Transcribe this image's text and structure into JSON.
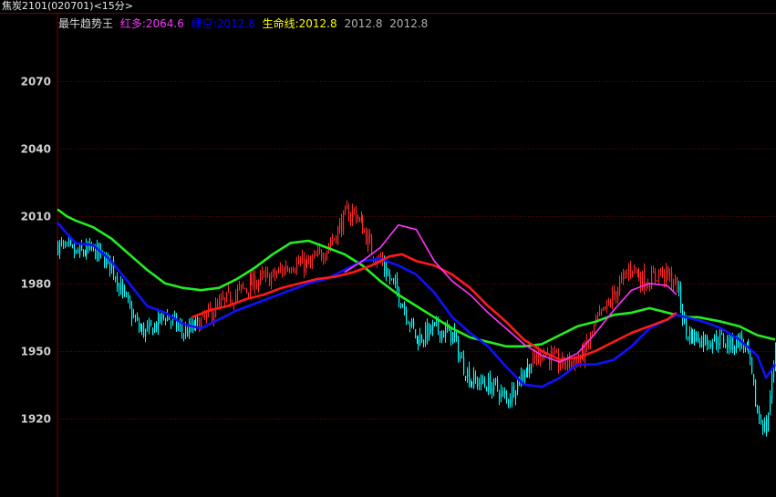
{
  "window": {
    "title": "焦炭2101(020701)<15分>"
  },
  "indicator": {
    "name": "最牛趋势王",
    "fields": [
      {
        "label": "红多:",
        "value": "2064.6",
        "color": "#ff33ff"
      },
      {
        "label": "绿空:",
        "value": "2012.8",
        "color": "#0000ff"
      },
      {
        "label": "生命线:",
        "value": "2012.8",
        "color": "#ffff00"
      }
    ],
    "extra_values": [
      "2012.8",
      "2012.8"
    ],
    "name_color": "#d8d8d8",
    "extra_color": "#b0b0b0"
  },
  "colors": {
    "background": "#000000",
    "grid": "#7a0000",
    "axis_text": "#d0d0d0",
    "up_candle": "#ff2a2a",
    "down_candle": "#00ffff",
    "red_line": "#ff1a1a",
    "blue_line": "#1010ff",
    "green_line": "#22ee22",
    "magenta_line": "#ff33ff"
  },
  "chart_data": {
    "type": "line",
    "title": "",
    "xlabel": "",
    "ylabel": "",
    "ylim": [
      1885,
      2100
    ],
    "yticks": [
      1920,
      1950,
      1980,
      2010,
      2040,
      2070
    ],
    "grid": true,
    "series": [
      {
        "name": "生命线",
        "color": "#22ee22",
        "x": [
          0,
          5,
          10,
          20,
          30,
          40,
          50,
          60,
          70,
          80,
          90,
          100,
          110,
          120,
          130,
          140,
          150,
          160,
          170,
          180,
          190,
          200,
          210,
          220,
          230,
          240,
          250,
          260,
          270,
          280,
          290,
          300,
          310,
          320,
          330,
          340,
          350,
          356,
          357,
          370,
          380,
          390,
          400
        ],
        "values": [
          2013,
          2010,
          2008,
          2005,
          2000,
          1993,
          1986,
          1980,
          1978,
          1977,
          1978,
          1982,
          1987,
          1993,
          1998,
          1999,
          1996,
          1993,
          1988,
          1981,
          1975,
          1970,
          1965,
          1960,
          1956,
          1954,
          1952,
          1952,
          1953,
          1957,
          1961,
          1963,
          1966,
          1967,
          1969,
          1967,
          1965,
          1965,
          1965,
          1963,
          1961,
          1957,
          1955
        ]
      },
      {
        "name": "红多",
        "color": "#ff33ff",
        "x": [
          160,
          170,
          180,
          190,
          200,
          210,
          220,
          230,
          240,
          250,
          260,
          270,
          280,
          290,
          300,
          310,
          320,
          330,
          340,
          345
        ],
        "values": [
          1985,
          1990,
          1996,
          2006,
          2004,
          1990,
          1981,
          1975,
          1967,
          1960,
          1953,
          1948,
          1945,
          1949,
          1958,
          1968,
          1977,
          1980,
          1979,
          1975
        ]
      },
      {
        "name": "绿空",
        "color": "#1010ff",
        "x": [
          0,
          10,
          20,
          30,
          40,
          50,
          60,
          70,
          80,
          90,
          100,
          110,
          120,
          130,
          140,
          150,
          160,
          170,
          180,
          190,
          200,
          210,
          220,
          230,
          240,
          250,
          260,
          270,
          280,
          290,
          300,
          310,
          320,
          330,
          340,
          345,
          350,
          360,
          370,
          380,
          390,
          395,
          400
        ],
        "values": [
          2007,
          1998,
          1997,
          1990,
          1980,
          1970,
          1967,
          1962,
          1960,
          1964,
          1968,
          1971,
          1974,
          1977,
          1980,
          1982,
          1986,
          1990,
          1991,
          1988,
          1984,
          1976,
          1965,
          1958,
          1952,
          1943,
          1935,
          1934,
          1938,
          1944,
          1944,
          1946,
          1952,
          1960,
          1964,
          1966,
          1965,
          1963,
          1960,
          1955,
          1948,
          1938,
          1944
        ]
      },
      {
        "name": "红线",
        "color": "#ff1a1a",
        "x": [
          75,
          85,
          95,
          105,
          115,
          125,
          135,
          145,
          155,
          165,
          175,
          180,
          185,
          192,
          200,
          210,
          220,
          230,
          240,
          250,
          260,
          270,
          280,
          290,
          300,
          310,
          320,
          330,
          340,
          345
        ],
        "values": [
          1965,
          1968,
          1970,
          1973,
          1975,
          1978,
          1980,
          1982,
          1983,
          1985,
          1988,
          1990,
          1992,
          1993,
          1990,
          1988,
          1984,
          1978,
          1970,
          1963,
          1955,
          1950,
          1946,
          1947,
          1950,
          1954,
          1958,
          1961,
          1964,
          1967
        ]
      }
    ],
    "candles_anchor": {
      "x": [
        0,
        10,
        20,
        30,
        35,
        40,
        45,
        50,
        60,
        70,
        75,
        80,
        90,
        100,
        110,
        120,
        130,
        140,
        150,
        155,
        160,
        165,
        170,
        175,
        180,
        185,
        190,
        195,
        200,
        210,
        220,
        225,
        230,
        240,
        245,
        250,
        255,
        260,
        265,
        270,
        280,
        290,
        295,
        300,
        305,
        310,
        315,
        320,
        325,
        330,
        335,
        340,
        345,
        350,
        360,
        370,
        375,
        380,
        385,
        390,
        395,
        400
      ],
      "close": [
        1997,
        1993,
        1995,
        1988,
        1978,
        1968,
        1960,
        1958,
        1966,
        1958,
        1960,
        1963,
        1970,
        1976,
        1981,
        1983,
        1989,
        1988,
        1996,
        2002,
        2010,
        2012,
        2005,
        1995,
        1990,
        1982,
        1975,
        1965,
        1955,
        1960,
        1957,
        1945,
        1937,
        1935,
        1933,
        1928,
        1935,
        1941,
        1945,
        1950,
        1944,
        1946,
        1951,
        1962,
        1968,
        1975,
        1982,
        1988,
        1982,
        1981,
        1985,
        1983,
        1979,
        1958,
        1955,
        1955,
        1953,
        1955,
        1948,
        1922,
        1915,
        1952
      ]
    }
  }
}
